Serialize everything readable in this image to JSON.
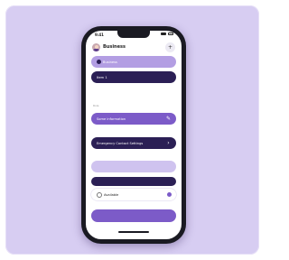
{
  "status_bar": {
    "time": "9:41"
  },
  "header": {
    "title": "Business",
    "action_icon": "plus-icon"
  },
  "rows": [
    {
      "label": "Business"
    },
    {
      "label": "Item 1"
    },
    {
      "label": "Some information"
    },
    {
      "label": "Emergency Contact Settings"
    },
    {
      "label": ""
    },
    {
      "label": ""
    },
    {
      "label": "Available"
    }
  ],
  "section_label": "Role",
  "colors": {
    "card_background": "#d7cdf2",
    "accent": "#7c5bc8",
    "dark": "#2b1f55",
    "light": "#b39ee3"
  }
}
